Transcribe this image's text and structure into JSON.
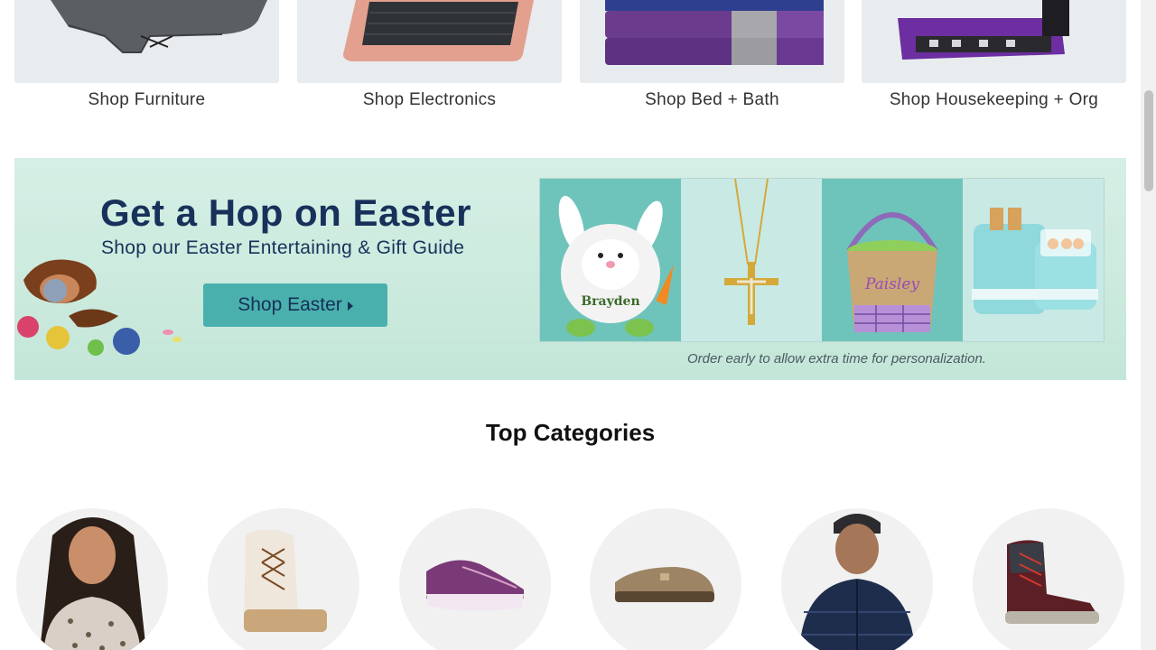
{
  "shop_tiles": [
    {
      "label": "Shop Furniture",
      "image": "recliner-chair"
    },
    {
      "label": "Shop Electronics",
      "image": "tablet-keyboard"
    },
    {
      "label": "Shop Bed + Bath",
      "image": "towel-stack"
    },
    {
      "label": "Shop Housekeeping + Org",
      "image": "vacuum-cleaner"
    }
  ],
  "banner": {
    "headline": "Get a Hop on Easter",
    "subheadline": "Shop our Easter Entertaining & Gift Guide",
    "button_label": "Shop Easter",
    "note": "Order early to allow extra time for personalization.",
    "bunny_name": "Brayden",
    "basket_name": "Paisley",
    "colors": {
      "background": "#cbeadd",
      "headline": "#17315a",
      "button": "#4ab0ad"
    }
  },
  "top_categories": {
    "title": "Top Categories",
    "items": [
      {
        "image": "woman-leopard-sweater"
      },
      {
        "image": "winter-lace-up-boot"
      },
      {
        "image": "purple-sneaker"
      },
      {
        "image": "suede-clog"
      },
      {
        "image": "man-puffer-jacket"
      },
      {
        "image": "hiking-boot"
      }
    ]
  }
}
